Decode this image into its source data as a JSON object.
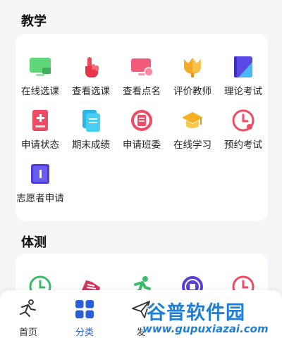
{
  "sections": {
    "teaching": {
      "title": "教学",
      "items": [
        {
          "label": "在线选课",
          "icon": "monitor-icon"
        },
        {
          "label": "查看选课",
          "icon": "hand-pointer-icon"
        },
        {
          "label": "查看点名",
          "icon": "screen-user-icon"
        },
        {
          "label": "评价教师",
          "icon": "tulip-icon"
        },
        {
          "label": "理论考试",
          "icon": "book-cover-icon"
        },
        {
          "label": "申请状态",
          "icon": "document-plus-icon"
        },
        {
          "label": "期末成绩",
          "icon": "stacked-papers-icon"
        },
        {
          "label": "申请班委",
          "icon": "clipboard-circle-icon"
        },
        {
          "label": "在线学习",
          "icon": "graduation-cap-icon"
        },
        {
          "label": "预约考试",
          "icon": "clock-icon"
        },
        {
          "label": "志愿者申请",
          "icon": "book-icon"
        }
      ]
    },
    "fitness": {
      "title": "体测",
      "items": [
        {
          "icon": "clock-green-icon"
        },
        {
          "icon": "running-shoe-icon"
        },
        {
          "icon": "runner-icon"
        },
        {
          "icon": "exempt-badge-icon"
        },
        {
          "icon": "clock-red-icon"
        }
      ]
    }
  },
  "tabbar": {
    "tabs": [
      {
        "label": "首页",
        "icon": "runner-outline-icon"
      },
      {
        "label": "分类",
        "icon": "grid-icon",
        "active": true
      },
      {
        "label": "发",
        "icon": "send-icon"
      }
    ]
  },
  "watermark": {
    "name": "谷普软件园",
    "url": "www.gupuxiazai.com"
  },
  "colors": {
    "accent": "#2b5fd9",
    "watermark": "#1e7fd6"
  }
}
